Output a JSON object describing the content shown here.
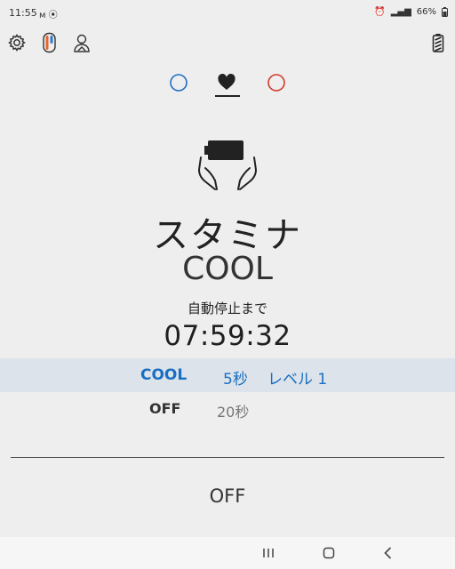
{
  "status_bar": {
    "time": "11:55",
    "battery": "66%"
  },
  "toolbar": {
    "settings_icon": "gear-icon",
    "device_icon": "device-icon",
    "user_icon": "user-icon",
    "battery_icon": "battery-icon"
  },
  "mode_tabs": [
    {
      "name": "blue-circle",
      "color": "#1f6fc6"
    },
    {
      "name": "heart",
      "color": "#222222",
      "selected": true
    },
    {
      "name": "red-circle",
      "color": "#d23a2e"
    }
  ],
  "main": {
    "mode_name": "スタミナ",
    "mode_sub": "COOL",
    "auto_stop_label": "自動停止まで",
    "timer": "07:59:32"
  },
  "options": {
    "row1": {
      "mode": "COOL",
      "interval": "5秒",
      "level": "レベル 1"
    },
    "row2": {
      "mode": "OFF",
      "interval": "20秒"
    }
  },
  "footer": {
    "off_label": "OFF"
  },
  "colors": {
    "accent": "#1a6fc2",
    "highlight_row": "#dce3ea",
    "background": "#eeeeee"
  }
}
